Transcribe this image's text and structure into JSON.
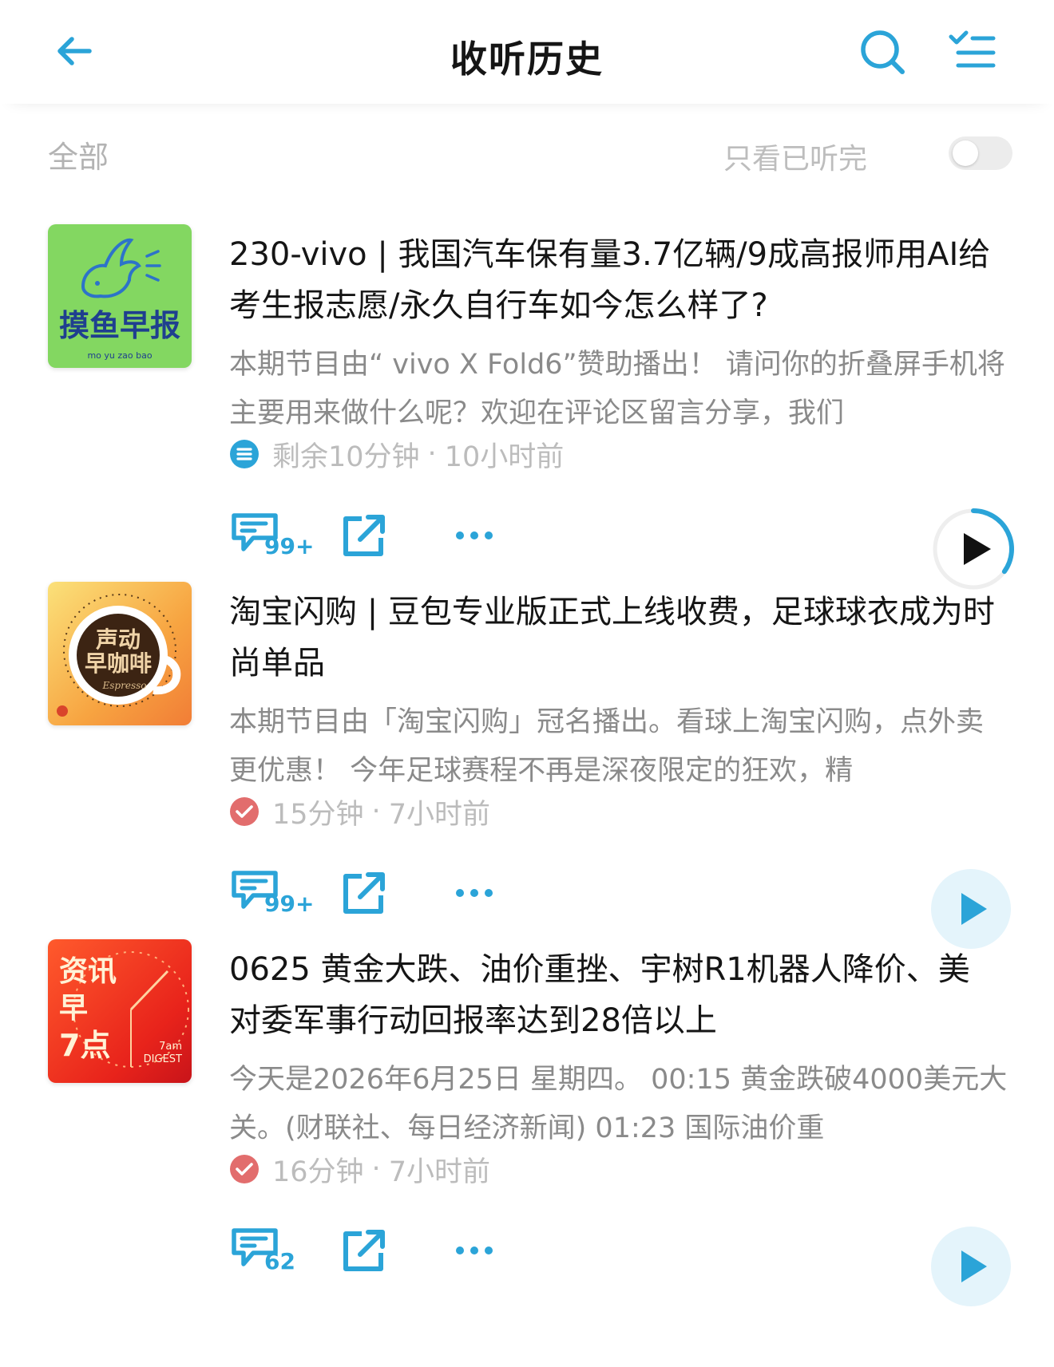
{
  "header": {
    "title": "收听历史"
  },
  "filter": {
    "all_label": "全部",
    "only_finished_label": "只看已听完",
    "only_finished_on": false
  },
  "episodes": [
    {
      "cover_text": "摸鱼早报",
      "cover_pinyin": "mo  yu  zao  bao",
      "title": "230-vivo | 我国汽车保有量3.7亿辆/9成高报师用AI给考生报志愿/永久自行车如今怎么样了?",
      "description": "本期节目由“ vivo X Fold6”赞助播出！ 请问你的折叠屏手机将主要用来做什么呢？欢迎在评论区留言分享，我们",
      "status_icon": "in-progress-icon",
      "duration": "剩余10分钟",
      "time_ago": "10小时前",
      "comment_count": "99+",
      "progress": 0.35
    },
    {
      "cover_text_1": "声动",
      "cover_text_2": "早咖啡",
      "cover_text_3": "Espresso",
      "title": "淘宝闪购 | 豆包专业版正式上线收费，足球球衣成为时尚单品",
      "description": "本期节目由「淘宝闪购」冠名播出。看球上淘宝闪购，点外卖更优惠！ 今年足球赛程不再是深夜限定的狂欢，精",
      "status_icon": "completed-check-icon",
      "duration": "15分钟",
      "time_ago": "7小时前",
      "comment_count": "99+",
      "progress": 1
    },
    {
      "cover_text_1": "资讯",
      "cover_text_2": "早",
      "cover_text_3": "7点",
      "cover_text_4": "7am",
      "cover_text_5": "DIGEST",
      "title": "0625 黄金大跌、油价重挫、宇树R1机器人降价、美对委军事行动回报率达到28倍以上",
      "description": "今天是2026年6月25日 星期四。 00:15 黄金跌破4000美元大关。(财联社、每日经济新闻) 01:23 国际油价重",
      "status_icon": "completed-check-icon",
      "duration": "16分钟",
      "time_ago": "7小时前",
      "comment_count": "62",
      "progress": 1
    }
  ],
  "separator": "·",
  "colors": {
    "accent": "#2ba4d8",
    "completed": "#e26d6d",
    "muted_text": "#8a8a8a"
  }
}
